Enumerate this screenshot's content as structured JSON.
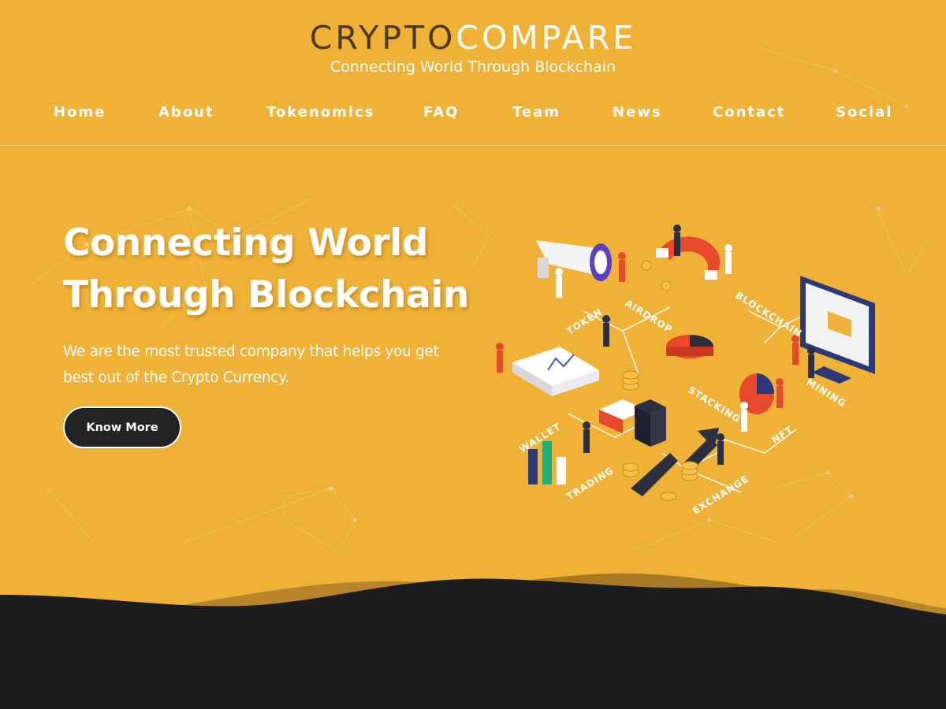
{
  "brand": {
    "logo_part1": "CRYPTO",
    "logo_part2": "COMPARE",
    "tagline": "Connecting World Through Blockchain"
  },
  "nav": {
    "items": [
      "Home",
      "About",
      "Tokenomics",
      "FAQ",
      "Team",
      "News",
      "Contact",
      "Social"
    ]
  },
  "hero": {
    "title_line1": "Connecting World",
    "title_line2": "Through Blockchain",
    "subtitle": "We are the most trusted company that helps you get best out of the Crypto Currency.",
    "button_label": "Know More"
  },
  "illustration": {
    "labels": {
      "token": "TOKEN",
      "airdrop": "AIRDROP",
      "blockchain": "BLOCKCHAIN",
      "mining": "MINING",
      "stacking": "STACKING",
      "nft": "NFT",
      "exchange": "EXCHANGE",
      "trading": "TRADING",
      "wallet": "WALLET"
    }
  },
  "colors": {
    "background": "#efb236",
    "dark": "#1b1c1e",
    "logo_dark": "#4a3a14",
    "text": "#ffffff"
  }
}
